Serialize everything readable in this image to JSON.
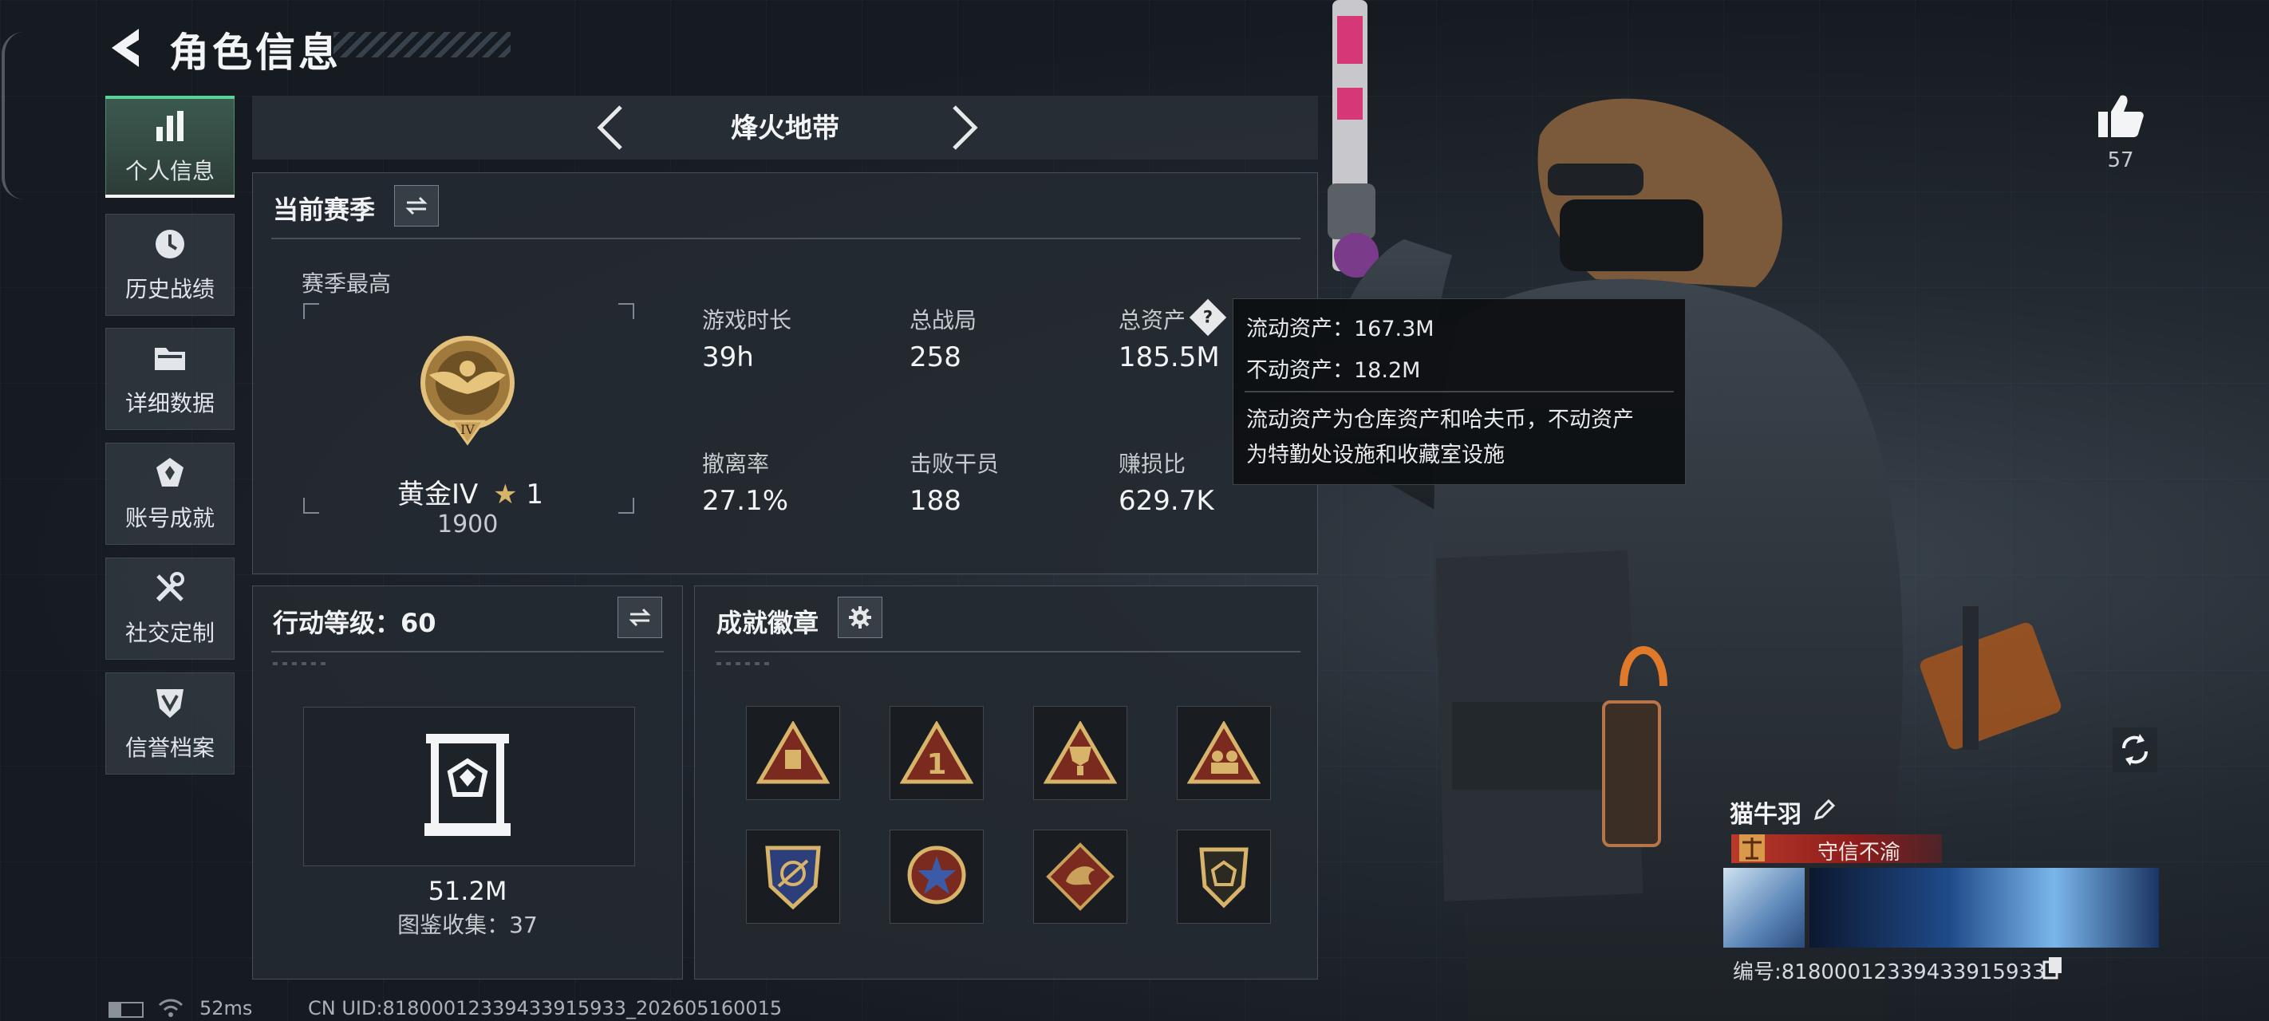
{
  "header": {
    "title": "角色信息"
  },
  "sidebar": {
    "items": [
      {
        "label": "个人信息",
        "icon": "bar-chart-icon",
        "active": true
      },
      {
        "label": "历史战绩",
        "icon": "clock-icon",
        "active": false
      },
      {
        "label": "详细数据",
        "icon": "folder-icon",
        "active": false
      },
      {
        "label": "账号成就",
        "icon": "achievement-icon",
        "active": false
      },
      {
        "label": "社交定制",
        "icon": "tools-icon",
        "active": false
      },
      {
        "label": "信誉档案",
        "icon": "shield-icon",
        "active": false
      }
    ]
  },
  "mode": {
    "name": "烽火地带"
  },
  "season": {
    "title": "当前赛季",
    "best_label": "赛季最高",
    "rank_name": "黄金IV",
    "rank_stars": "1",
    "rank_score": "1900",
    "stats": [
      {
        "label": "游戏时长",
        "value": "39h"
      },
      {
        "label": "总战局",
        "value": "258"
      },
      {
        "label": "总资产",
        "value": "185.5M"
      },
      {
        "label": "撤离率",
        "value": "27.1%"
      },
      {
        "label": "击败干员",
        "value": "188"
      },
      {
        "label": "赚损比",
        "value": "629.7K"
      }
    ]
  },
  "tooltip": {
    "liquid": "流动资产：167.3M",
    "fixed": "不动资产：18.2M",
    "desc_line1": "流动资产为仓库资产和哈夫币，不动资产",
    "desc_line2": "为特勤处设施和收藏室设施"
  },
  "action_level": {
    "title": "行动等级：60",
    "value": "51.2M",
    "collection": "图鉴收集：37"
  },
  "badges": {
    "title": "成就徽章",
    "items": [
      "badge-1",
      "badge-2",
      "badge-3",
      "badge-4",
      "badge-5",
      "badge-6",
      "badge-7",
      "badge-8"
    ]
  },
  "likes": {
    "count": "57"
  },
  "player": {
    "name": "猫牛羽",
    "title": "守信不渝",
    "id": "编号:8180001233943391593​3"
  },
  "status": {
    "ping": "52ms",
    "uid": "CN UID:81800012339433915933_202605160015"
  },
  "colors": {
    "accent_green": "#58d39a",
    "title_red": "#8c1c1c",
    "gold": "#c9a15a"
  }
}
